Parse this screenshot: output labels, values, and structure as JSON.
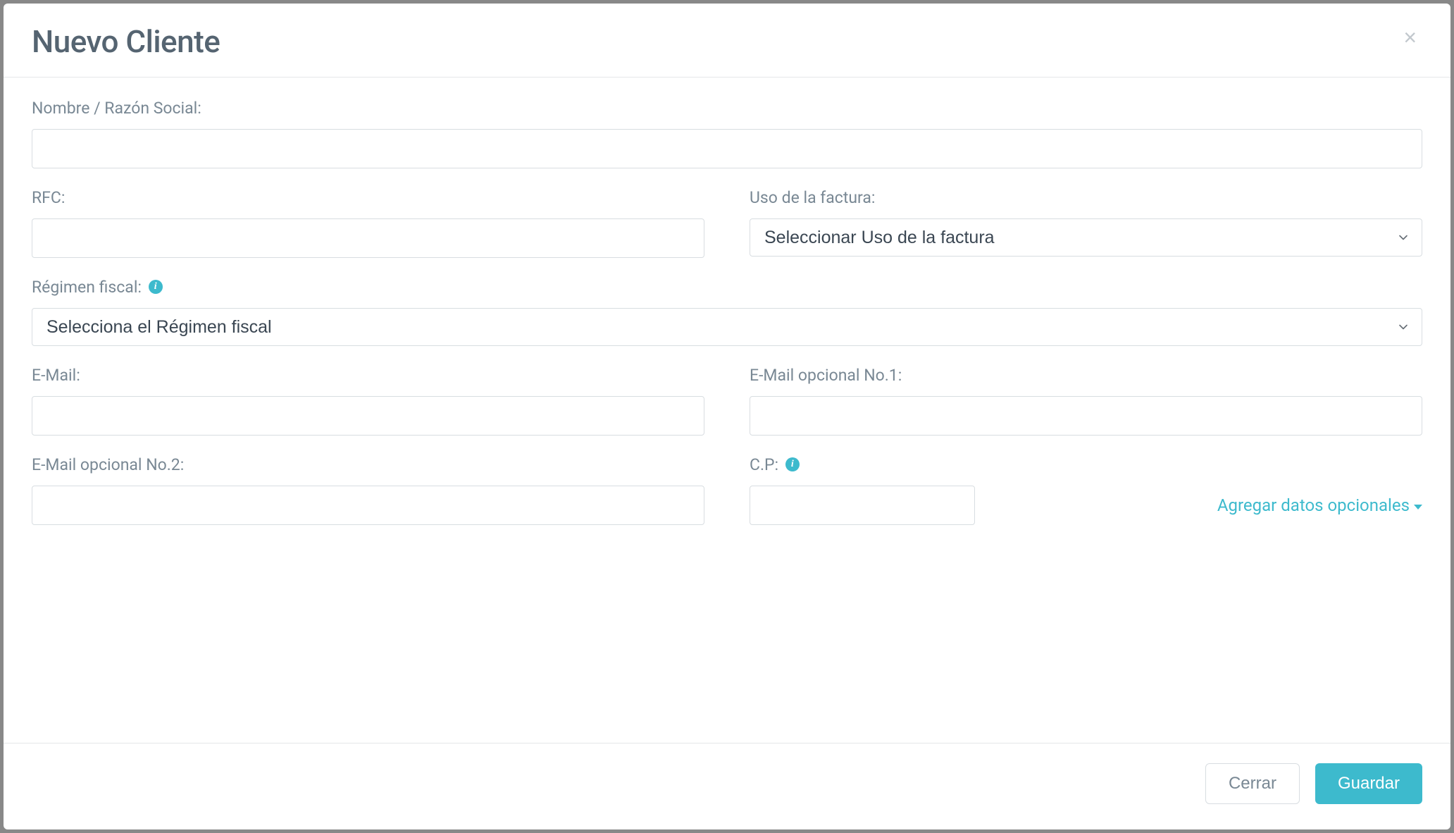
{
  "modal": {
    "title": "Nuevo Cliente",
    "labels": {
      "nombre": "Nombre / Razón Social:",
      "rfc": "RFC:",
      "usoFactura": "Uso de la factura:",
      "regimenFiscal": "Régimen fiscal:",
      "email": "E-Mail:",
      "emailOpt1": "E-Mail opcional No.1:",
      "emailOpt2": "E-Mail opcional No.2:",
      "cp": "C.P:"
    },
    "placeholders": {
      "usoFactura": "Seleccionar Uso de la factura",
      "regimenFiscal": "Selecciona el Régimen fiscal"
    },
    "values": {
      "nombre": "",
      "rfc": "",
      "email": "",
      "emailOpt1": "",
      "emailOpt2": "",
      "cp": ""
    },
    "links": {
      "optionalData": "Agregar datos opcionales"
    },
    "buttons": {
      "close": "Cerrar",
      "save": "Guardar"
    }
  }
}
